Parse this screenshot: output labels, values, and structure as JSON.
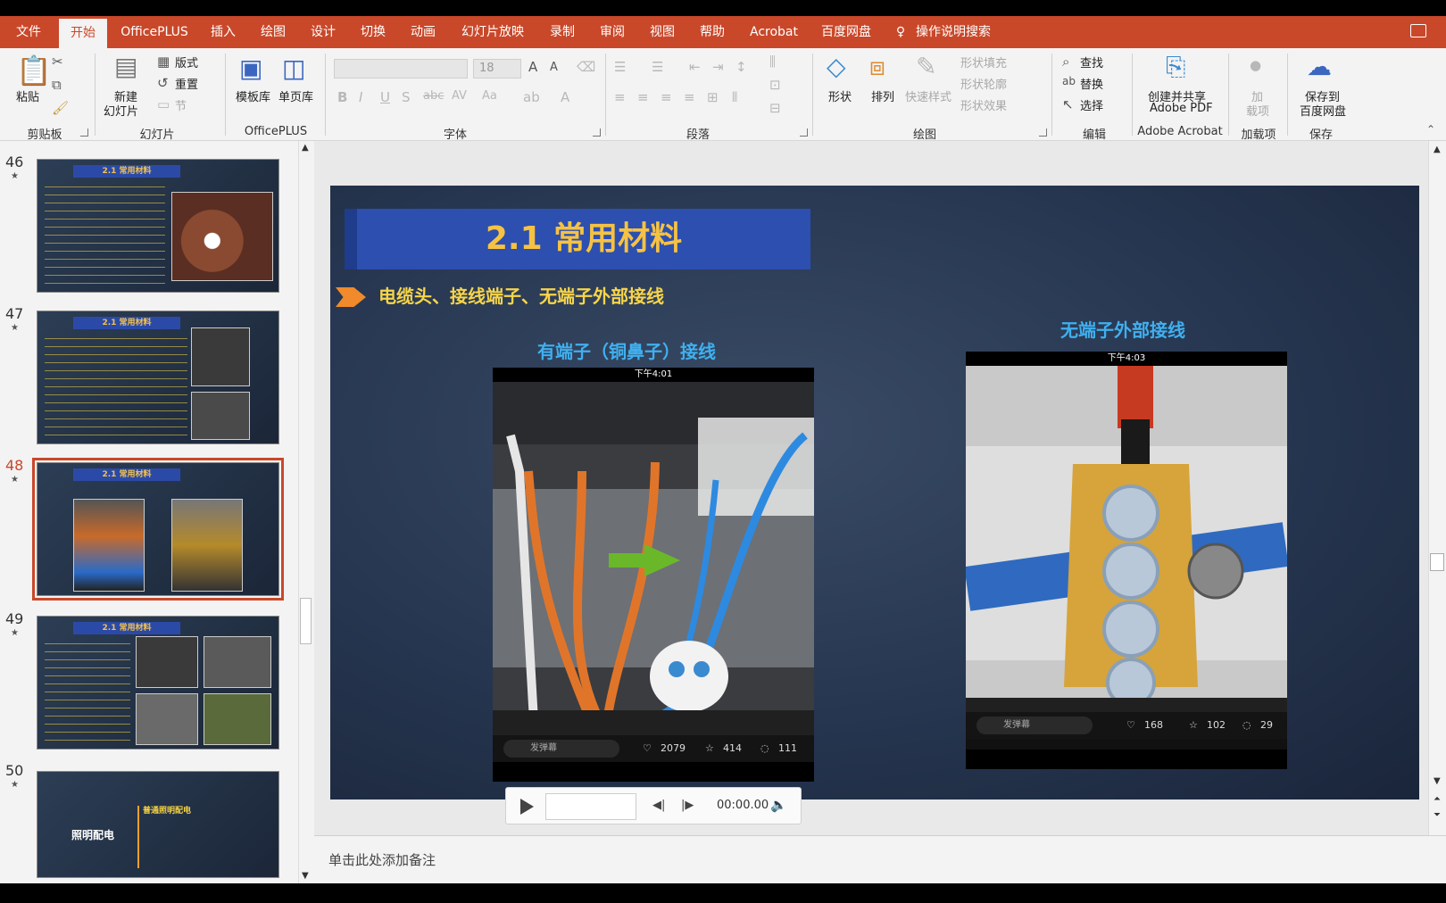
{
  "tabs": [
    "文件",
    "开始",
    "OfficePLUS",
    "插入",
    "绘图",
    "设计",
    "切换",
    "动画",
    "幻灯片放映",
    "录制",
    "审阅",
    "视图",
    "帮助",
    "Acrobat",
    "百度网盘"
  ],
  "active_tab": "开始",
  "search": {
    "label": "操作说明搜索"
  },
  "ribbon": {
    "clipboard": {
      "paste": "粘贴",
      "group": "剪贴板"
    },
    "slides": {
      "new_slide_line1": "新建",
      "new_slide_line2": "幻灯片",
      "layout": "版式",
      "reset": "重置",
      "section": "节",
      "group": "幻灯片"
    },
    "officeplus": {
      "template": "模板库",
      "single_page": "单页库",
      "group": "OfficePLUS"
    },
    "font": {
      "size": "18",
      "group": "字体"
    },
    "paragraph": {
      "group": "段落"
    },
    "drawing": {
      "shapes": "形状",
      "arrange": "排列",
      "quick_styles": "快速样式",
      "shape_fill": "形状填充",
      "shape_outline": "形状轮廓",
      "shape_effects": "形状效果",
      "group": "绘图"
    },
    "editing": {
      "find": "查找",
      "replace": "替换",
      "select": "选择",
      "group": "编辑"
    },
    "acrobat": {
      "create_line1": "创建并共享",
      "create_line2": "Adobe PDF",
      "group": "Adobe Acrobat"
    },
    "addins": {
      "line1": "加",
      "line2": "载项",
      "group": "加载项"
    },
    "baidu": {
      "line1": "保存到",
      "line2": "百度网盘",
      "group": "保存"
    }
  },
  "thumbnails": [
    {
      "num": "46",
      "title": "2.1 常用材料"
    },
    {
      "num": "47",
      "title": "2.1 常用材料"
    },
    {
      "num": "48",
      "title": "2.1 常用材料"
    },
    {
      "num": "49",
      "title": "2.1 常用材料"
    },
    {
      "num": "50",
      "title": "照明配电",
      "sub": "普通照明配电"
    }
  ],
  "selected_slide": "48",
  "slide": {
    "title": "2.1 常用材料",
    "subtitle": "电缆头、接线端子、无端子外部接线",
    "caption_left": "有端子（铜鼻子）接线",
    "caption_right": "无端子外部接线",
    "left_phone": {
      "time": "下午4:01",
      "danmu": "发弹幕",
      "likes": "2079",
      "favs": "414",
      "comments": "111"
    },
    "right_phone": {
      "time": "下午4:03",
      "danmu": "发弹幕",
      "likes": "168",
      "favs": "102",
      "comments": "29"
    }
  },
  "media": {
    "time": "00:00.00"
  },
  "notes": {
    "placeholder": "单击此处添加备注"
  },
  "colors": {
    "accent": "#c9482a",
    "slide_title_bg": "#2d4fb0",
    "slide_title_text": "#f5c242",
    "caption": "#3fb0f0"
  }
}
